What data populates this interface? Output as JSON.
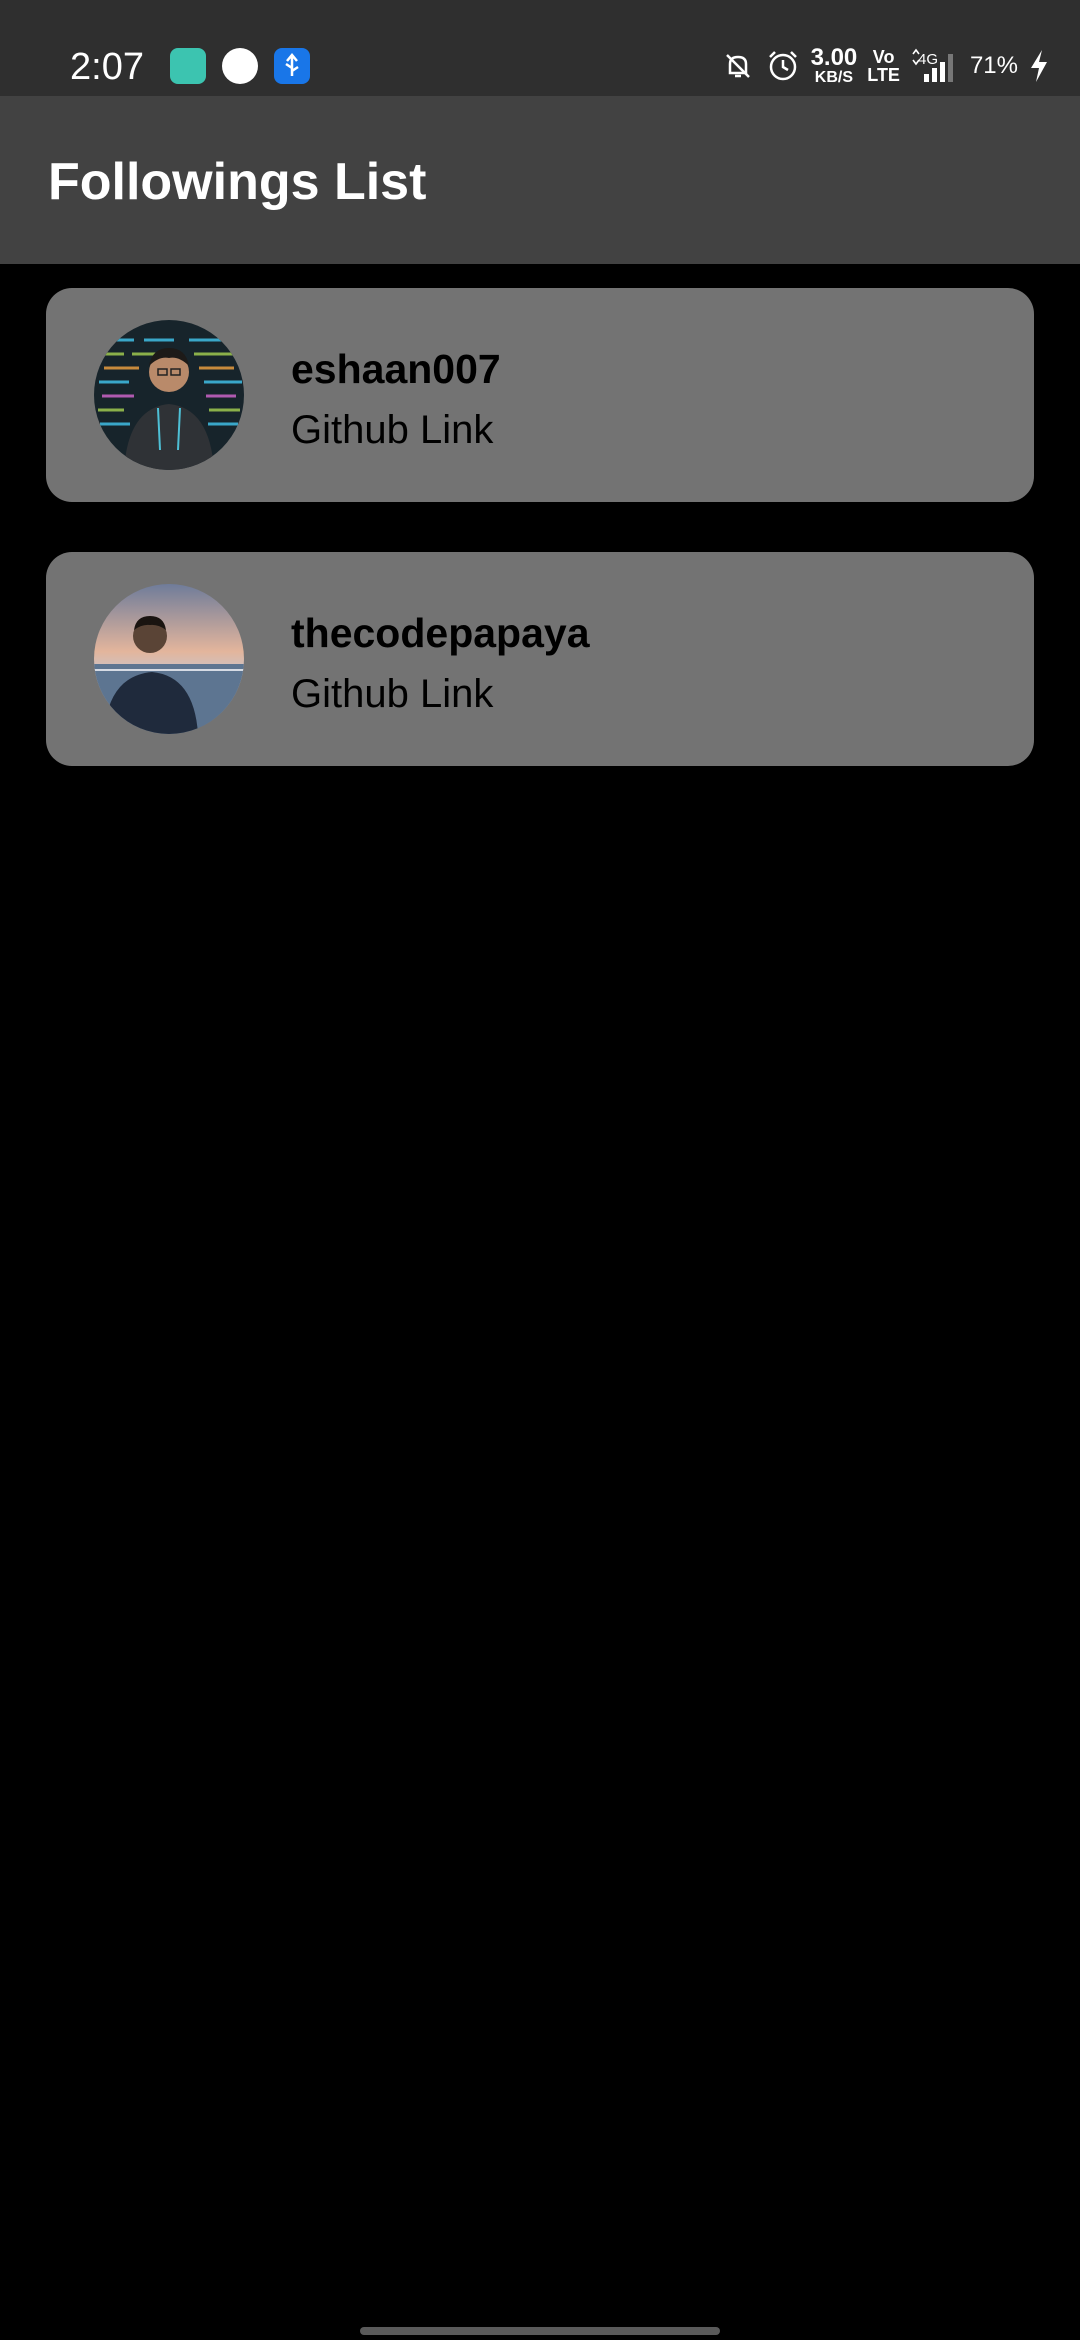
{
  "status_bar": {
    "time": "2:07",
    "net_speed_value": "3.00",
    "net_speed_unit": "KB/S",
    "volte_top": "Vo",
    "volte_bottom": "LTE",
    "network_type": "4G",
    "battery_percent": "71%",
    "icons": [
      "app-notification-icon",
      "circle-notification-icon",
      "usb-icon",
      "bell-off-icon",
      "alarm-icon",
      "signal-icon",
      "charging-icon"
    ]
  },
  "app_bar": {
    "title": "Followings List"
  },
  "followings": [
    {
      "username": "eshaan007",
      "link_label": "Github Link"
    },
    {
      "username": "thecodepapaya",
      "link_label": "Github Link"
    }
  ],
  "colors": {
    "status_bar_bg": "#2f2f2f",
    "app_bar_bg": "#424242",
    "page_bg": "#000000",
    "card_bg": "#737373"
  }
}
